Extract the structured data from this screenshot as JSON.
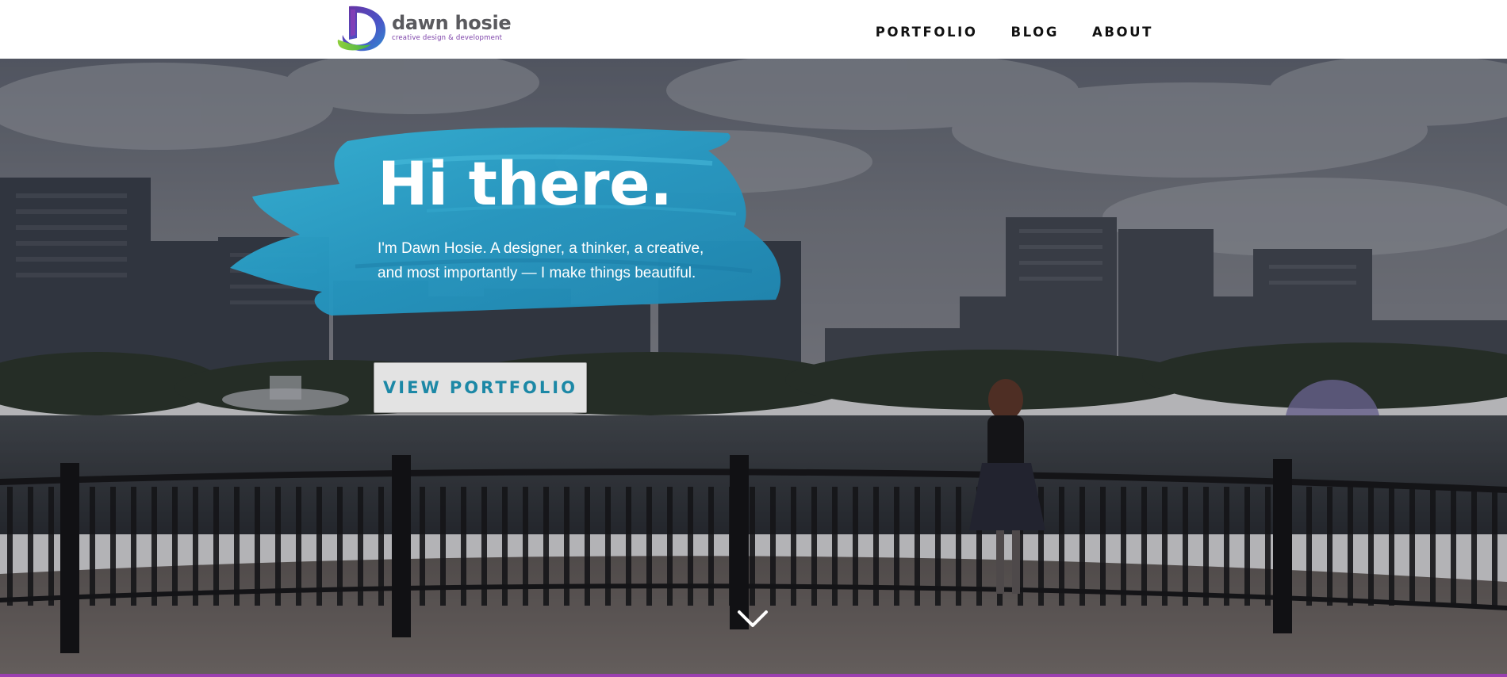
{
  "header": {
    "logo": {
      "name": "dawn hosie",
      "tagline": "creative design & development"
    },
    "nav": [
      {
        "label": "PORTFOLIO"
      },
      {
        "label": "BLOG"
      },
      {
        "label": "ABOUT"
      }
    ]
  },
  "hero": {
    "title": "Hi there.",
    "intro": "I'm Dawn Hosie. A designer, a thinker, a creative, and most importantly — I make things beautiful.",
    "cta_label": "VIEW PORTFOLIO"
  },
  "icons": {
    "scroll": "chevron-down-icon",
    "logo": "dawn-hosie-logo-mark"
  },
  "colors": {
    "brand_purple": "#9b3fb0",
    "brush_blue": "#2da3c8",
    "cta_text": "#1c88a6",
    "nav_text": "#111111"
  }
}
